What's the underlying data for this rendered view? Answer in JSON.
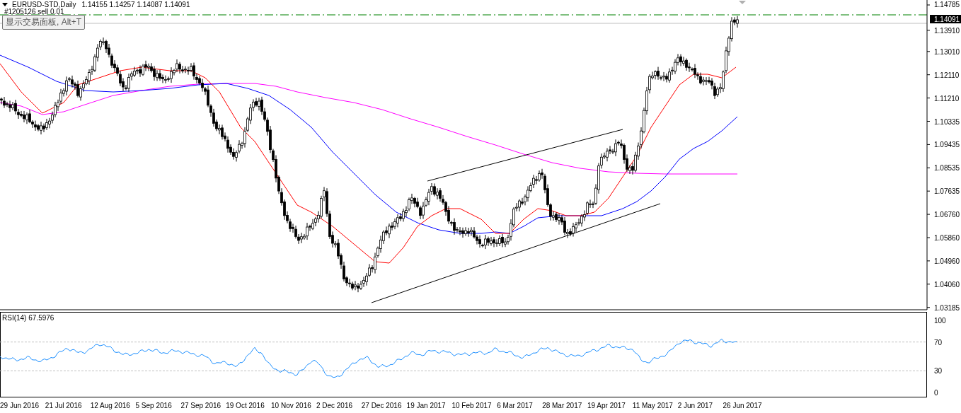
{
  "chart": {
    "symbol_caption": "EURUSD-STD,Daily",
    "ohlc": [
      "1.14155",
      "1.14257",
      "1.14087",
      "1.14091"
    ],
    "order_label": "#1205126 sell 0.01",
    "tooltip": "显示交易面板, Alt+T",
    "current_price": "1.14091",
    "price_ticks": [
      "1.14785",
      "1.13910",
      "1.13010",
      "1.12110",
      "1.11210",
      "1.10335",
      "1.09435",
      "1.08535",
      "1.07635",
      "1.06760",
      "1.05860",
      "1.04960",
      "1.04060",
      "1.03185"
    ]
  },
  "rsi": {
    "caption": "RSI(14) 67.5976",
    "ticks": [
      "100",
      "70",
      "30",
      "0"
    ]
  },
  "dates": [
    "29 Jun 2016",
    "21 Jul 2016",
    "12 Aug 2016",
    "5 Sep 2016",
    "27 Sep 2016",
    "19 Oct 2016",
    "10 Nov 2016",
    "2 Dec 2016",
    "27 Dec 2016",
    "19 Jan 2017",
    "10 Feb 2017",
    "6 Mar 2017",
    "28 Mar 2017",
    "19 Apr 2017",
    "11 May 2017",
    "2 Jun 2017",
    "26 Jun 2017"
  ]
}
